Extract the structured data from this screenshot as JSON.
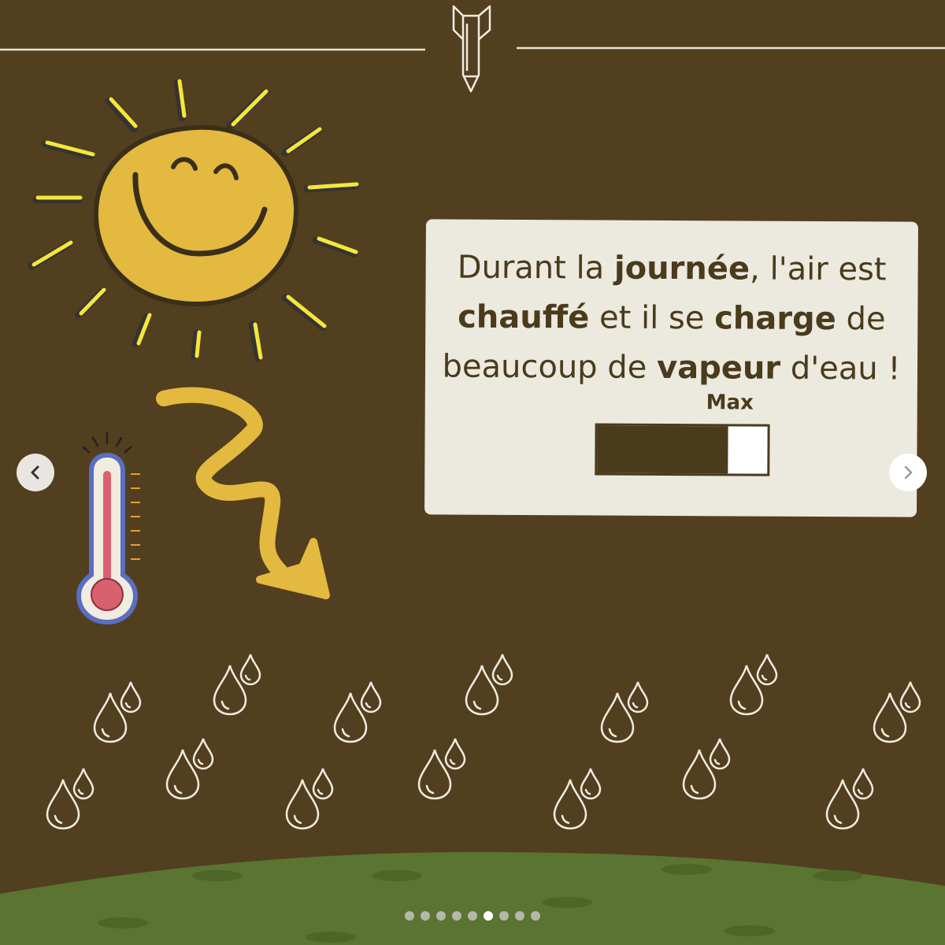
{
  "card": {
    "line1_a": "Durant la ",
    "line1_b": "journée",
    "line1_c": ", l'air est",
    "line2_a": "chauffé",
    "line2_b": " et il se ",
    "line2_c": "charge",
    "line2_d": " de",
    "line3_a": "beaucoup de ",
    "line3_b": "vapeur",
    "line3_c": " d'eau !"
  },
  "meter": {
    "label": "Max",
    "level_percent": 77
  },
  "carousel": {
    "total_slides": 9,
    "active_index": 5
  },
  "icons": {
    "top": "rocket-icon",
    "sun": "smiling-sun-icon",
    "thermometer": "thermometer-icon",
    "arrow": "zigzag-arrow-icon",
    "drops": "water-drops-icon",
    "prev": "chevron-left-icon",
    "next": "chevron-right-icon"
  },
  "colors": {
    "background": "#523f1f",
    "card": "#ece9df",
    "text": "#4a3b1c",
    "sun": "#e3b940",
    "grass": "#5a7431"
  }
}
